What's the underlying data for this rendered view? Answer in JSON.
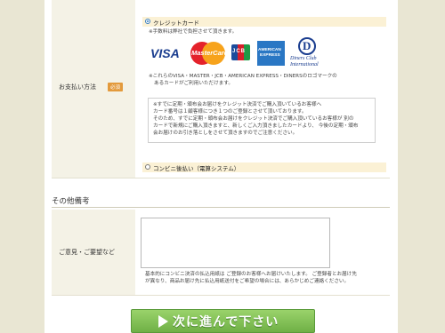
{
  "payment": {
    "label": "お支払い方法",
    "required_badge": "必須",
    "credit_option": "クレジットカード",
    "fee_note": "※手数料は弊社で負担させて頂きます。",
    "accepted_note_line1": "※これらのVISA・MASTER・JCB・AMERICAN EXPRESS・DINERSのロゴマークの",
    "accepted_note_line2": "あるカードがご利用いただけます。",
    "notice_lines": [
      "※すでに定期・頒布会お届けをクレジット決済でご購入頂いているお客様へ",
      "カード番号は１顧客様につき１つのご登録とさせて頂いております。",
      "そのため、すでに定期・頒布会お届けをクレジット決済でご購入頂いているお客様が 別の",
      "カードで新規にご購入頂きますと、新しくご入力頂きましたカードより、 今後の定期・頒布",
      "会お届けのお引き落としをさせて頂きますのでご注意ください。"
    ],
    "convenience_option": "コンビニ後払い（電算システム）",
    "cards": {
      "visa": "VISA",
      "master": "MasterCard",
      "jcb": "JCB",
      "amex_line1": "AMERICAN",
      "amex_line2": "EXPRESS",
      "diners_mark": "D",
      "diners_line1": "Diners Club",
      "diners_line2": "International"
    }
  },
  "other": {
    "section_title": "その他備考",
    "comment_label": "ご意見・ご要望など",
    "comment_value": "",
    "note_line1": "基本的にコンビニ決済の払込用紙は ご登録のお客様へお届けいたします。 ご登録者とお届け先",
    "note_line2": "が異なり、商品お届け先に払込用紙送付をご希望の場合には、あらかじめご連絡ください。"
  },
  "next_button": {
    "label": "次に進んで下さい"
  },
  "colors": {
    "button_green": "#7cc050",
    "badge_orange": "#e39a3c",
    "option_highlight": "#fbf1d5"
  }
}
